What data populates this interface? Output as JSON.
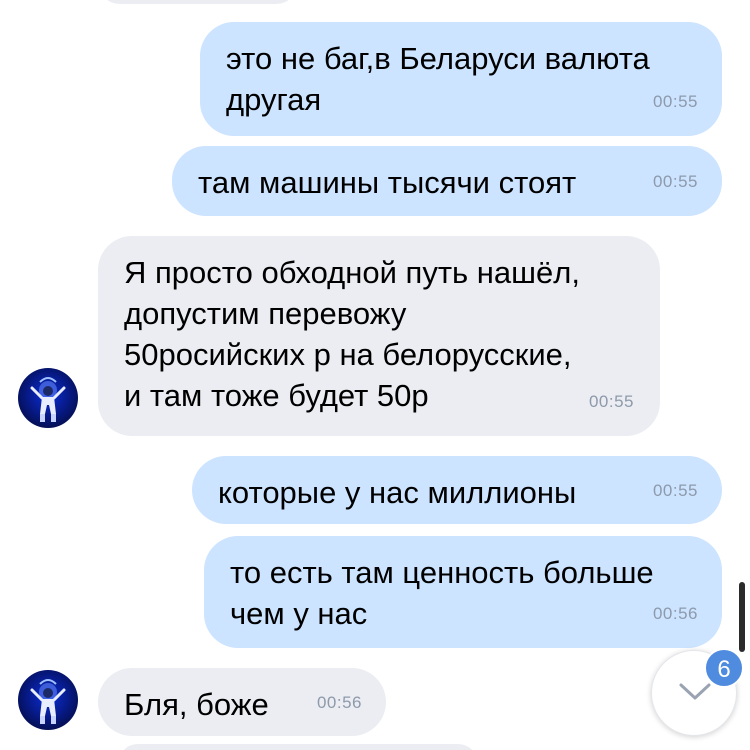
{
  "messages": [
    {
      "side": "out",
      "text": "это не баг,в Беларуси валюта\nдругая",
      "time": "00:55"
    },
    {
      "side": "out",
      "text": "там машины тысячи стоят",
      "time": "00:55"
    },
    {
      "side": "in",
      "text": "Я просто обходной путь нашёл,\nдопустим перевожу\n50росийских р на белорусские,\nи там тоже будет 50р",
      "time": "00:55"
    },
    {
      "side": "out",
      "text": "которые у нас миллионы",
      "time": "00:55"
    },
    {
      "side": "out",
      "text": "то есть там ценность больше\nчем у нас",
      "time": "00:56"
    },
    {
      "side": "in",
      "text": "Бля, боже",
      "time": "00:56"
    }
  ],
  "scroll_to_bottom": {
    "unread_count": "6",
    "icon": "chevron-down-icon"
  },
  "colors": {
    "outgoing_bubble": "#cce4ff",
    "incoming_bubble": "#ebedf2",
    "badge": "#4f8bde",
    "timestamp": "#8e9aab"
  }
}
